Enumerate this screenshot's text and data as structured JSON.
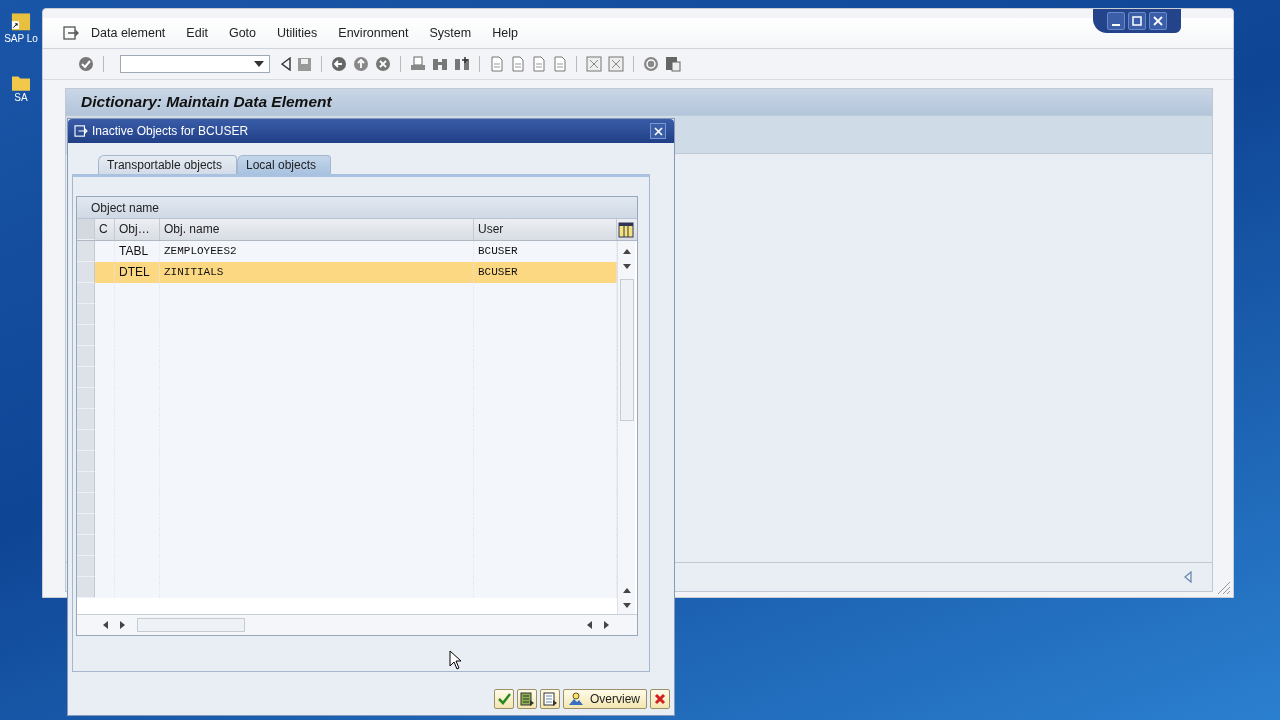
{
  "desktop": {
    "icons": [
      {
        "label": "SAP Lo",
        "kind": "shortcut"
      },
      {
        "label": "SA",
        "kind": "folder"
      }
    ]
  },
  "window": {
    "menu": [
      "Data element",
      "Edit",
      "Goto",
      "Utilities",
      "Environment",
      "System",
      "Help"
    ],
    "screen_title": "Dictionary: Maintain Data Element"
  },
  "dialog": {
    "title": "Inactive Objects for BCUSER",
    "tabs": [
      {
        "label": "Transportable objects",
        "selected": false
      },
      {
        "label": "Local objects",
        "selected": true
      }
    ],
    "table": {
      "group_header": "Object name",
      "columns": [
        "C",
        "Obj…",
        "Obj. name",
        "User"
      ],
      "rows": [
        {
          "cells": [
            "",
            "TABL",
            "ZEMPLOYEES2",
            "BCUSER"
          ],
          "selected": false
        },
        {
          "cells": [
            "",
            "DTEL",
            "ZINITIALS",
            "BCUSER"
          ],
          "selected": true
        }
      ]
    },
    "buttons": [
      {
        "kind": "check"
      },
      {
        "kind": "list"
      },
      {
        "kind": "doc"
      },
      {
        "kind": "overview",
        "label": "Overview"
      },
      {
        "kind": "cancel"
      }
    ]
  }
}
